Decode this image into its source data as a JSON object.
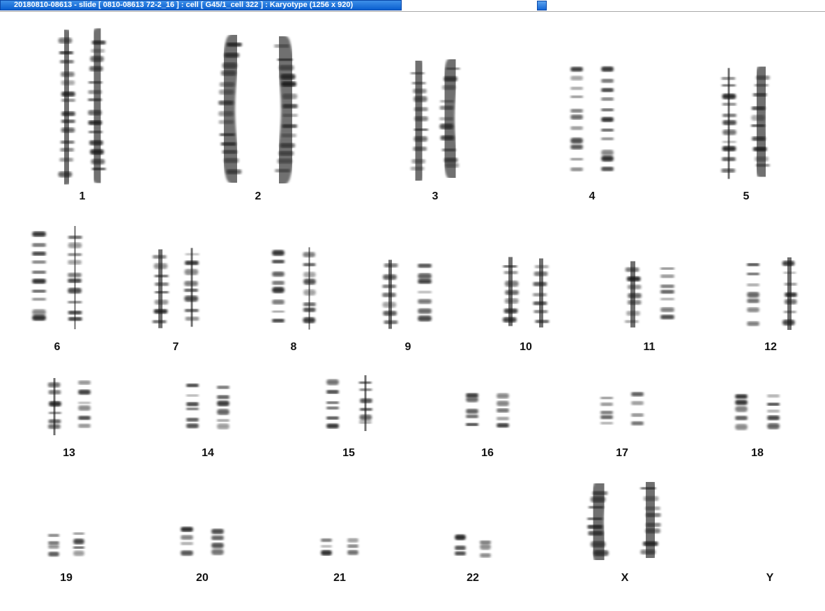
{
  "window": {
    "title": "20180810-08613 - slide [ 0810-08613 72-2_16 ] : cell [ G45/1_cell 322 ] : Karyotype  (1256 x 920)"
  },
  "karyotype": {
    "labels": [
      "1",
      "2",
      "3",
      "4",
      "5",
      "6",
      "7",
      "8",
      "9",
      "10",
      "11",
      "12",
      "13",
      "14",
      "15",
      "16",
      "17",
      "18",
      "19",
      "20",
      "21",
      "22",
      "X",
      "Y"
    ]
  },
  "colors": {
    "title_bar": "#0a5fd0",
    "chromosome": "#4a4a4a",
    "band": "#141414",
    "label": "#111111"
  }
}
